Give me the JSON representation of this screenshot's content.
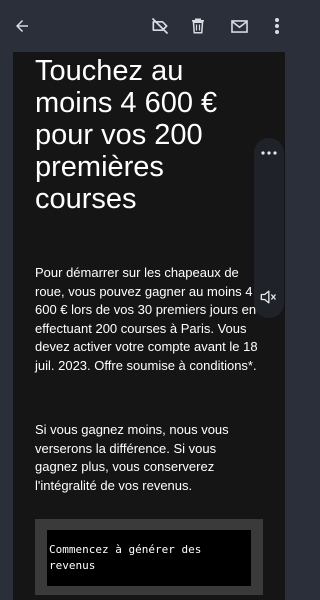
{
  "appbar": {
    "icons": [
      "back-arrow-icon",
      "label-off-icon",
      "delete-icon",
      "mail-icon",
      "more-vert-icon"
    ]
  },
  "email": {
    "headline": "Touchez au moins 4 600 € pour vos 200 premières courses",
    "paragraph1": "Pour démarrer sur les chapeaux de roue, vous pouvez gagner au moins 4 600 € lors de vos 30 premiers jours en effectuant 200 courses à Paris. Vous devez activer votre compte avant le 18 juil. 2023. Offre soumise à conditions*.",
    "paragraph2": "Si vous gagnez moins, nous vous verserons la différence. Si vous gagnez plus, vous conserverez l'intégralité de vos revenus.",
    "cta_label": "Commencez à générer des revenus"
  },
  "floating_panel": {
    "icons": [
      "more-horiz-icon",
      "volume-off-icon"
    ]
  },
  "colors": {
    "appbar_bg": "#2a2f3a",
    "card_bg": "#151515",
    "cta_frame": "#3a3a3a",
    "cta_bg": "#000000"
  }
}
